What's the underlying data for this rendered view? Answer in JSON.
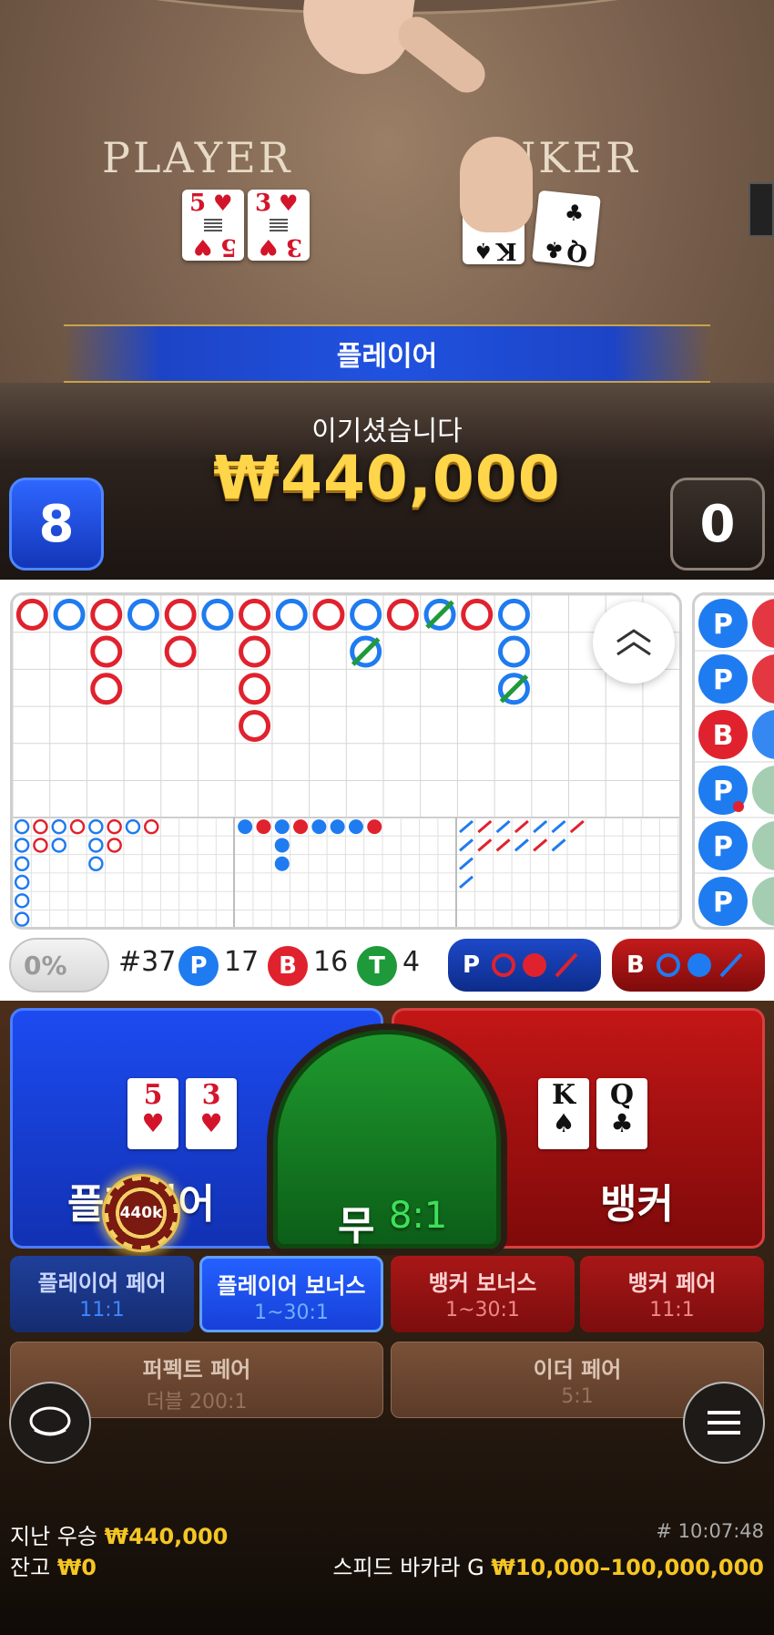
{
  "video": {
    "table_labels": {
      "player": "PLAYER",
      "banker": "NKER"
    },
    "player_cards": [
      {
        "rank": "5",
        "suit": "♥"
      },
      {
        "rank": "3",
        "suit": "♥"
      }
    ],
    "banker_cards": [
      {
        "rank": "K",
        "suit": "♠"
      },
      {
        "rank": "Q",
        "suit": "♣"
      }
    ],
    "result_banner": "플레이어",
    "win_title": "이기셨습니다",
    "win_amount": "₩440,000",
    "player_score": "8",
    "banker_score": "0"
  },
  "roadmap": {
    "colors": {
      "player": "#1f7bf0",
      "banker": "#e0222e",
      "tie": "#1e9a3a"
    },
    "side_road_labels": [
      "P",
      "P",
      "B",
      "P",
      "P",
      "P"
    ]
  },
  "stats": {
    "percent": "0%",
    "rounds": "#37",
    "player_label": "P",
    "player_count": "17",
    "banker_label": "B",
    "banker_count": "16",
    "tie_label": "T",
    "tie_count": "4",
    "predict_player": "P",
    "predict_banker": "B"
  },
  "bets": {
    "player_title": "플레이어",
    "player_cards": [
      {
        "rank": "5",
        "suit": "♥"
      },
      {
        "rank": "3",
        "suit": "♥"
      }
    ],
    "banker_cards": [
      {
        "rank": "K",
        "suit": "♠"
      },
      {
        "rank": "Q",
        "suit": "♣"
      }
    ],
    "chip_amount": "440k",
    "tie_title": "무",
    "tie_odds": "8:1",
    "banker_title": "뱅커",
    "side": [
      {
        "title": "플레이어 페어",
        "odds": "11:1"
      },
      {
        "title": "플레이어 보너스",
        "odds": "1~30:1"
      },
      {
        "title": "뱅커 보너스",
        "odds": "1~30:1"
      },
      {
        "title": "뱅커 페어",
        "odds": "11:1"
      }
    ],
    "wide": [
      {
        "title": "퍼펙트 페어",
        "odds": "더블 200:1"
      },
      {
        "title": "이더 페어",
        "odds": "5:1"
      }
    ]
  },
  "footer": {
    "last_win_label": "지난 우승",
    "last_win_value": "₩440,000",
    "balance_label": "잔고",
    "balance_value": "₩0",
    "round_id": "# 10:07:48",
    "game_name": "스피드 바카라 G",
    "bet_limits": "₩10,000–100,000,000"
  },
  "icons": {
    "chat": "chat-bubble-icon",
    "menu": "hamburger-menu-icon",
    "scroll": "double-chevron-up-icon"
  }
}
